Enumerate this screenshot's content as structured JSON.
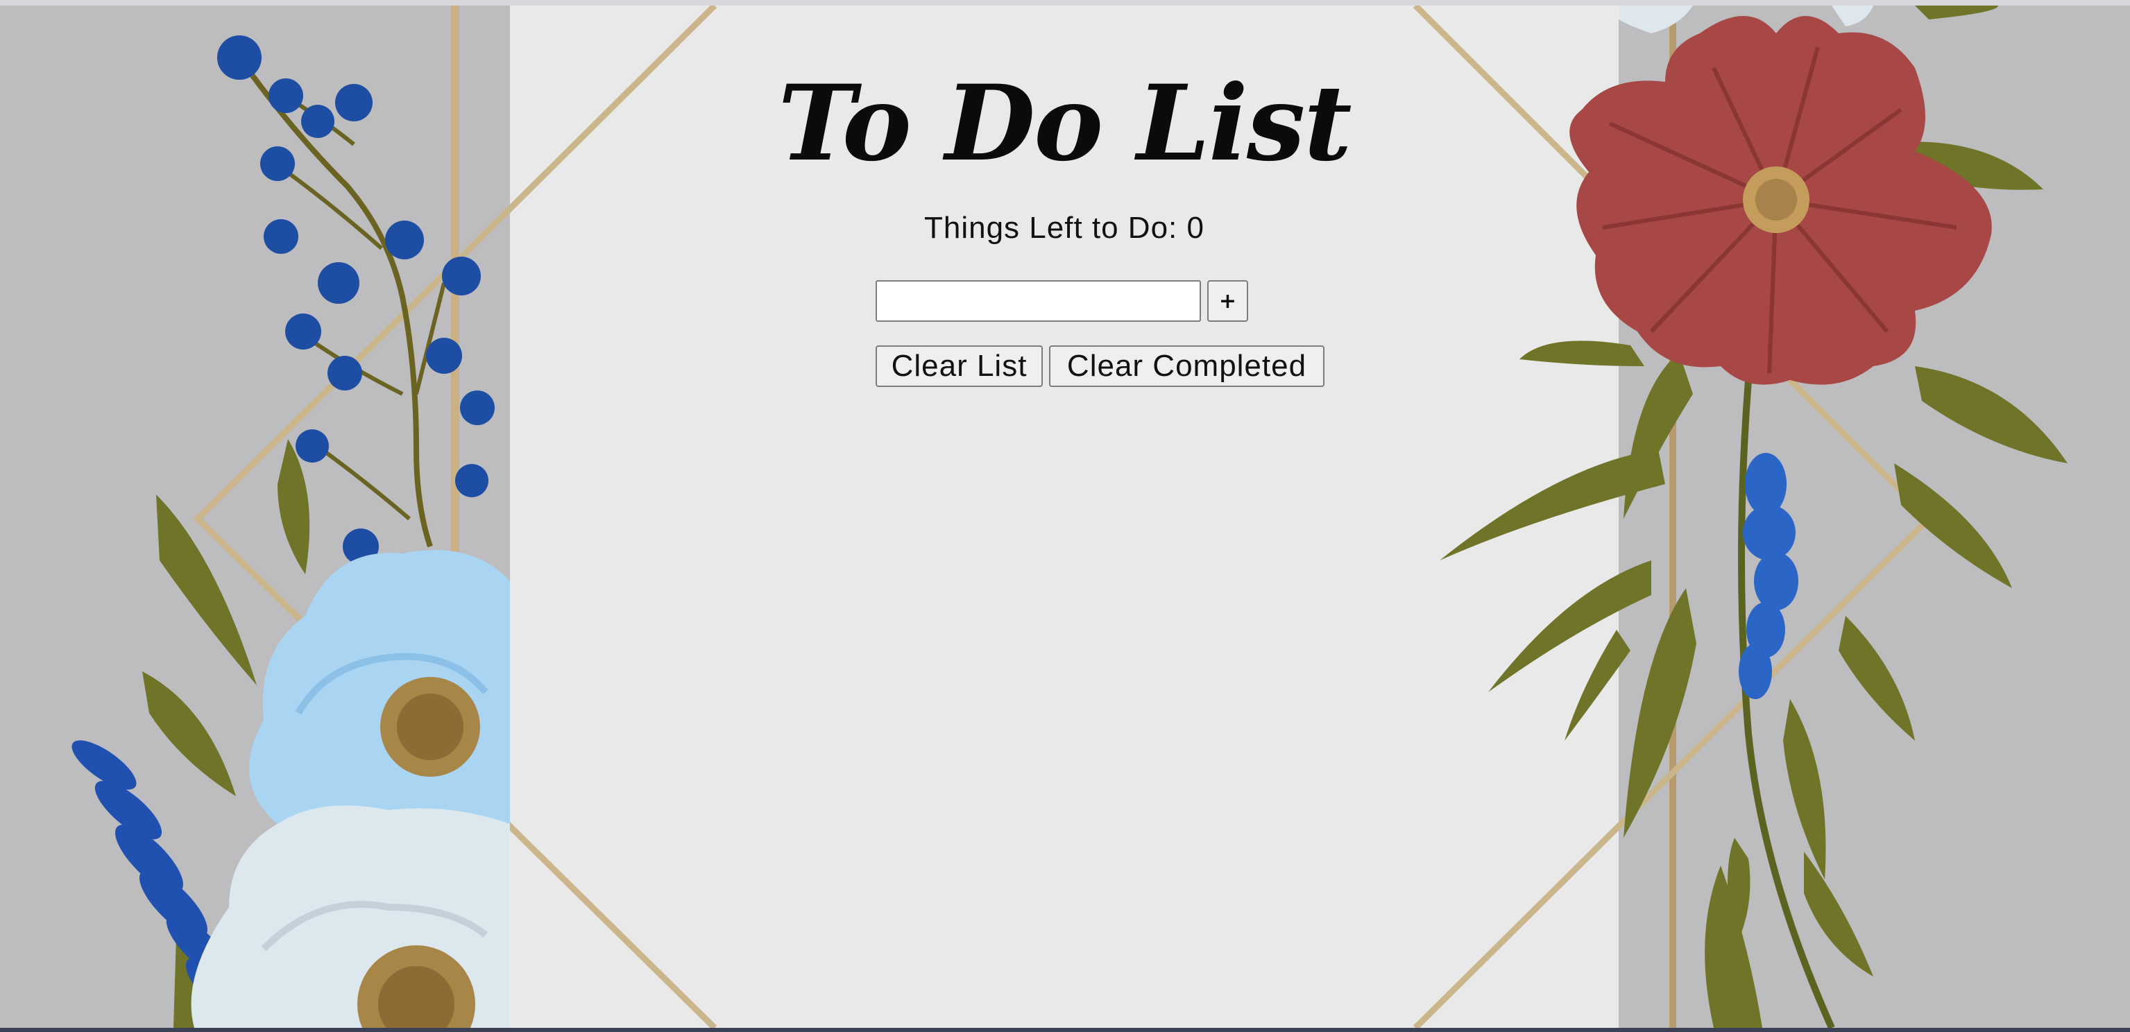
{
  "app": {
    "title": "To Do List",
    "counter_label": "Things Left to Do:",
    "counter_value": "0"
  },
  "form": {
    "input_value": "",
    "input_placeholder": "",
    "add_button_label": "+"
  },
  "actions": {
    "clear_list_label": "Clear List",
    "clear_completed_label": "Clear Completed"
  },
  "colors": {
    "background": "#bdbdbf",
    "panel": "#e9e9ea",
    "gold_frame": "#c9b183",
    "red_flower": "#a84846",
    "blue_berries": "#1d4ea3",
    "light_blue_flower": "#a9d5f3",
    "white_flower": "#dde7ee",
    "leaf_green": "#6f7428"
  },
  "decor": {
    "icons": [
      "blue-berries-icon",
      "light-blue-flower-icon",
      "white-flower-icon",
      "lavender-icon",
      "red-flower-icon",
      "leaf-icon",
      "gold-frame-icon"
    ]
  }
}
